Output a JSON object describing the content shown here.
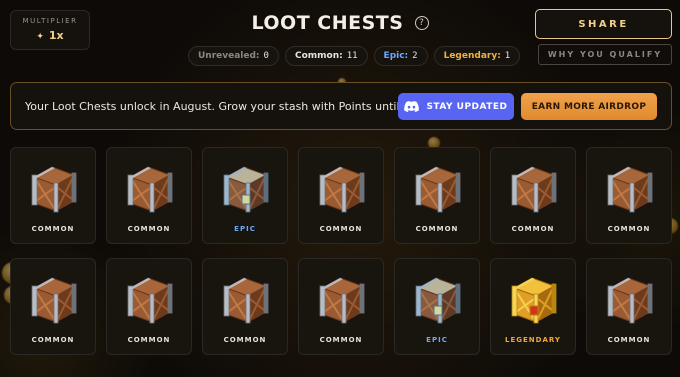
{
  "header": {
    "multiplier_label": "MULTIPLIER",
    "multiplier_value": "1x",
    "title": "LOOT CHESTS",
    "help_glyph": "?",
    "share_label": "SHARE",
    "qualify_label": "WHY YOU QUALIFY"
  },
  "counters": [
    {
      "label": "Unrevealed:",
      "value": "0"
    },
    {
      "label": "Common:",
      "value": "11"
    },
    {
      "label": "Epic:",
      "value": "2"
    },
    {
      "label": "Legendary:",
      "value": "1"
    }
  ],
  "banner": {
    "text": "Your Loot Chests unlock in August. Grow your stash with Points until then.",
    "discord_label": "STAY UPDATED",
    "earn_label": "EARN MORE AIRDROP"
  },
  "chests": [
    {
      "rarity": "COMMON",
      "kind": "common"
    },
    {
      "rarity": "COMMON",
      "kind": "common"
    },
    {
      "rarity": "EPIC",
      "kind": "epic"
    },
    {
      "rarity": "COMMON",
      "kind": "common"
    },
    {
      "rarity": "COMMON",
      "kind": "common"
    },
    {
      "rarity": "COMMON",
      "kind": "common"
    },
    {
      "rarity": "COMMON",
      "kind": "common"
    },
    {
      "rarity": "COMMON",
      "kind": "common"
    },
    {
      "rarity": "COMMON",
      "kind": "common"
    },
    {
      "rarity": "COMMON",
      "kind": "common"
    },
    {
      "rarity": "COMMON",
      "kind": "common"
    },
    {
      "rarity": "EPIC",
      "kind": "epic"
    },
    {
      "rarity": "LEGENDARY",
      "kind": "legendary"
    },
    {
      "rarity": "COMMON",
      "kind": "common"
    }
  ],
  "colors": {
    "accent_gold": "#f2d28e",
    "epic_blue": "#6fa7ff",
    "legendary_orange": "#f0a63c",
    "discord": "#5865f2",
    "earn_orange": "#f0a24b"
  },
  "icons": {
    "multiplier": "sparkle-icon",
    "help": "question-circle-icon",
    "discord": "discord-icon",
    "chest_common": "wooden-chest-icon",
    "chest_epic": "epic-chest-icon",
    "chest_legendary": "legendary-chest-icon"
  }
}
